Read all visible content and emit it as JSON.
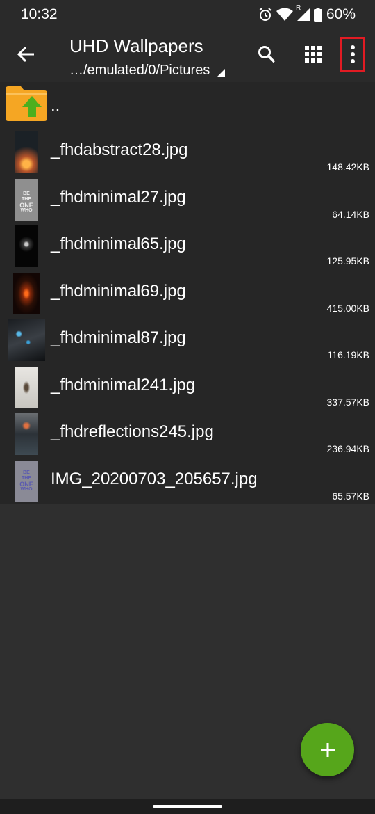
{
  "status_bar": {
    "time": "10:32",
    "battery": "60%",
    "network_badge": "R"
  },
  "app_bar": {
    "title": "UHD Wallpapers",
    "path": "…/emulated/0/Pictures"
  },
  "parent_folder": {
    "label": "..",
    "icon": "folder-up-icon"
  },
  "files": [
    {
      "name": "_fhdabstract28.jpg",
      "size": "148.42KB"
    },
    {
      "name": "_fhdminimal27.jpg",
      "size": "64.14KB"
    },
    {
      "name": "_fhdminimal65.jpg",
      "size": "125.95KB"
    },
    {
      "name": "_fhdminimal69.jpg",
      "size": "415.00KB"
    },
    {
      "name": "_fhdminimal87.jpg",
      "size": "116.19KB"
    },
    {
      "name": "_fhdminimal241.jpg",
      "size": "337.57KB"
    },
    {
      "name": "_fhdreflections245.jpg",
      "size": "236.94KB"
    },
    {
      "name": "IMG_20200703_205657.jpg",
      "size": "65.57KB"
    }
  ],
  "thumb_text": {
    "one_who_words": [
      "BE",
      "THE",
      "ONE",
      "WHO"
    ]
  },
  "colors": {
    "accent_fab": "#56a61b",
    "highlight_box": "#e21b23",
    "folder": "#f5a623",
    "folder_arrow": "#4caf1e"
  }
}
